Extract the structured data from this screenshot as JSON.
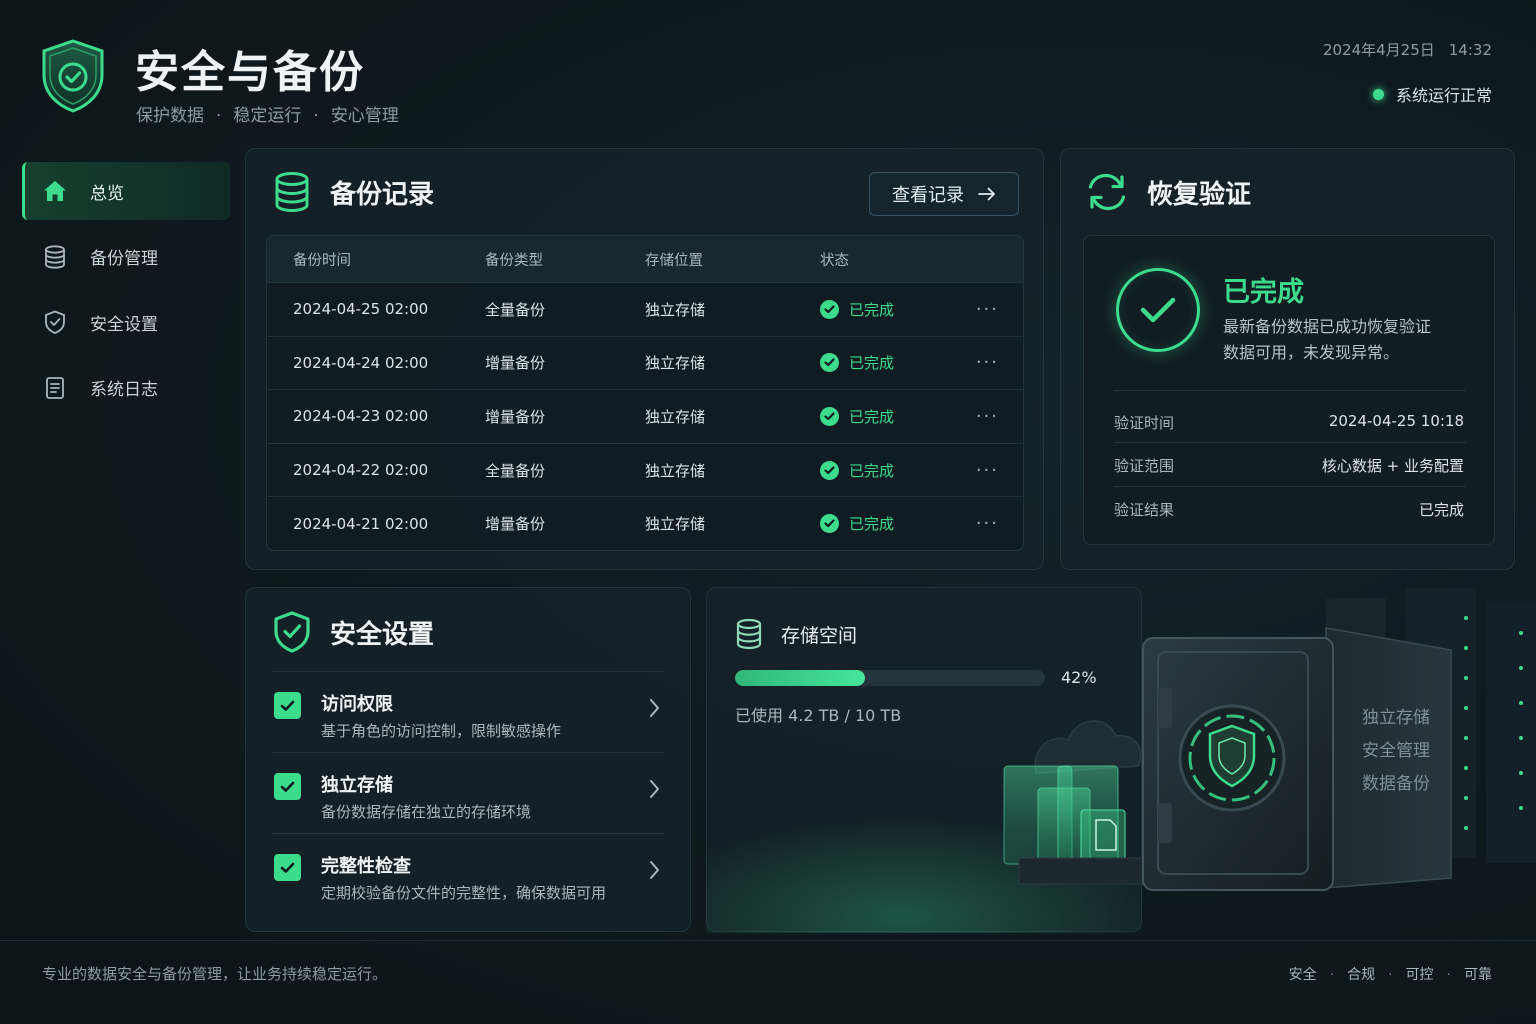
{
  "header": {
    "title": "安全与备份",
    "subtitle": [
      "保护数据",
      "稳定运行",
      "安心管理"
    ],
    "date": "2024年4月25日",
    "time": "14:32",
    "system_status": "系统运行正常"
  },
  "sidebar": {
    "items": [
      {
        "label": "总览",
        "icon": "home-icon",
        "active": true
      },
      {
        "label": "备份管理",
        "icon": "database-icon",
        "active": false
      },
      {
        "label": "安全设置",
        "icon": "shield-check-icon",
        "active": false
      },
      {
        "label": "系统日志",
        "icon": "document-icon",
        "active": false
      }
    ]
  },
  "backup": {
    "title": "备份记录",
    "view_button": "查看记录",
    "columns": [
      "备份时间",
      "备份类型",
      "存储位置",
      "状态"
    ],
    "rows": [
      {
        "time": "2024-04-25 02:00",
        "type": "全量备份",
        "location": "独立存储",
        "status": "已完成"
      },
      {
        "time": "2024-04-24 02:00",
        "type": "增量备份",
        "location": "独立存储",
        "status": "已完成"
      },
      {
        "time": "2024-04-23 02:00",
        "type": "增量备份",
        "location": "独立存储",
        "status": "已完成"
      },
      {
        "time": "2024-04-22 02:00",
        "type": "全量备份",
        "location": "独立存储",
        "status": "已完成"
      },
      {
        "time": "2024-04-21 02:00",
        "type": "增量备份",
        "location": "独立存储",
        "status": "已完成"
      }
    ],
    "more_label": "···"
  },
  "restore": {
    "title": "恢复验证",
    "status_title": "已完成",
    "description_lines": [
      "最新备份数据已成功恢复验证",
      "数据可用，未发现异常。"
    ],
    "details": [
      {
        "label": "验证时间",
        "value": "2024-04-25 10:18"
      },
      {
        "label": "验证范围",
        "value": "核心数据 + 业务配置"
      },
      {
        "label": "验证结果",
        "value": "已完成"
      }
    ]
  },
  "security": {
    "title": "安全设置",
    "items": [
      {
        "name": "访问权限",
        "desc": "基于角色的访问控制，限制敏感操作",
        "checked": true
      },
      {
        "name": "独立存储",
        "desc": "备份数据存储在独立的存储环境",
        "checked": true
      },
      {
        "name": "完整性检查",
        "desc": "定期校验备份文件的完整性，确保数据可用",
        "checked": true
      }
    ]
  },
  "storage": {
    "title": "存储空间",
    "used_fraction": 0.42,
    "percent_label": "42%",
    "used_label": "已使用",
    "used": "4.2 TB",
    "total": "10 TB",
    "safe_labels": [
      "独立存储",
      "安全管理",
      "数据备份"
    ]
  },
  "footer": {
    "text": "专业的数据安全与备份管理，让业务持续稳定运行。",
    "tags": [
      "安全",
      "合规",
      "可控",
      "可靠"
    ]
  },
  "colors": {
    "accent": "#3ddc8c",
    "background": "#0f1a20",
    "card": "#152229"
  }
}
